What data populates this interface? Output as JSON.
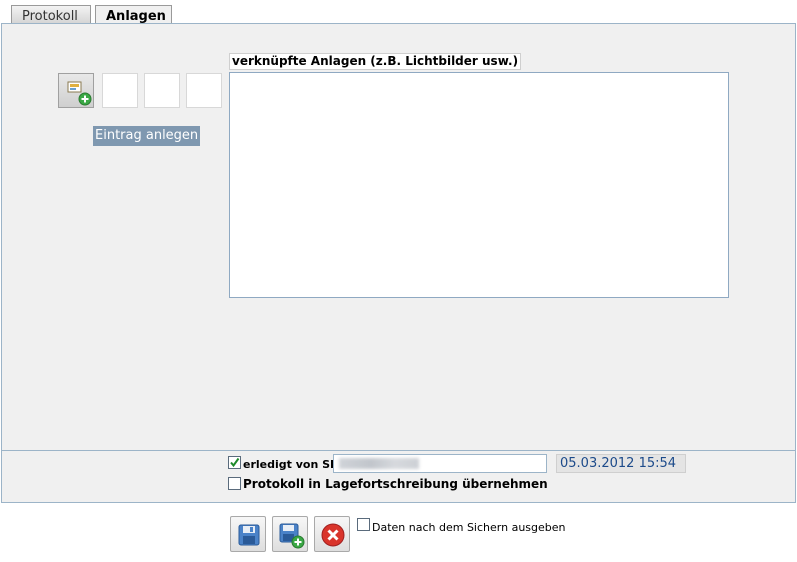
{
  "tabs": [
    {
      "label": "Protokoll"
    },
    {
      "label": "Anlagen"
    }
  ],
  "toolbar": {
    "create_entry_label": "Eintrag anlegen",
    "add_icon": "add-attachment-icon"
  },
  "attachments": {
    "title": "verknüpfte Anlagen (z.B. Lichtbilder usw.)"
  },
  "footer": {
    "done_by_label": "erledigt von SB",
    "done_by_checked": true,
    "timestamp": "05.03.2012 15:54",
    "transfer_label": "Protokoll in Lagefortschreibung übernehmen",
    "transfer_checked": false
  },
  "actions": {
    "save_icon": "save-icon",
    "save_new_icon": "save-and-new-icon",
    "cancel_icon": "cancel-icon",
    "print_after_save_label": "Daten nach dem Sichern ausgeben",
    "print_after_save_checked": false
  },
  "colors": {
    "panel_bg": "#f0f0f0",
    "panel_border": "#9cb4c8",
    "label_bg": "#7f98b0",
    "timestamp_text": "#1c4a8a",
    "cancel_red": "#d9342b"
  }
}
